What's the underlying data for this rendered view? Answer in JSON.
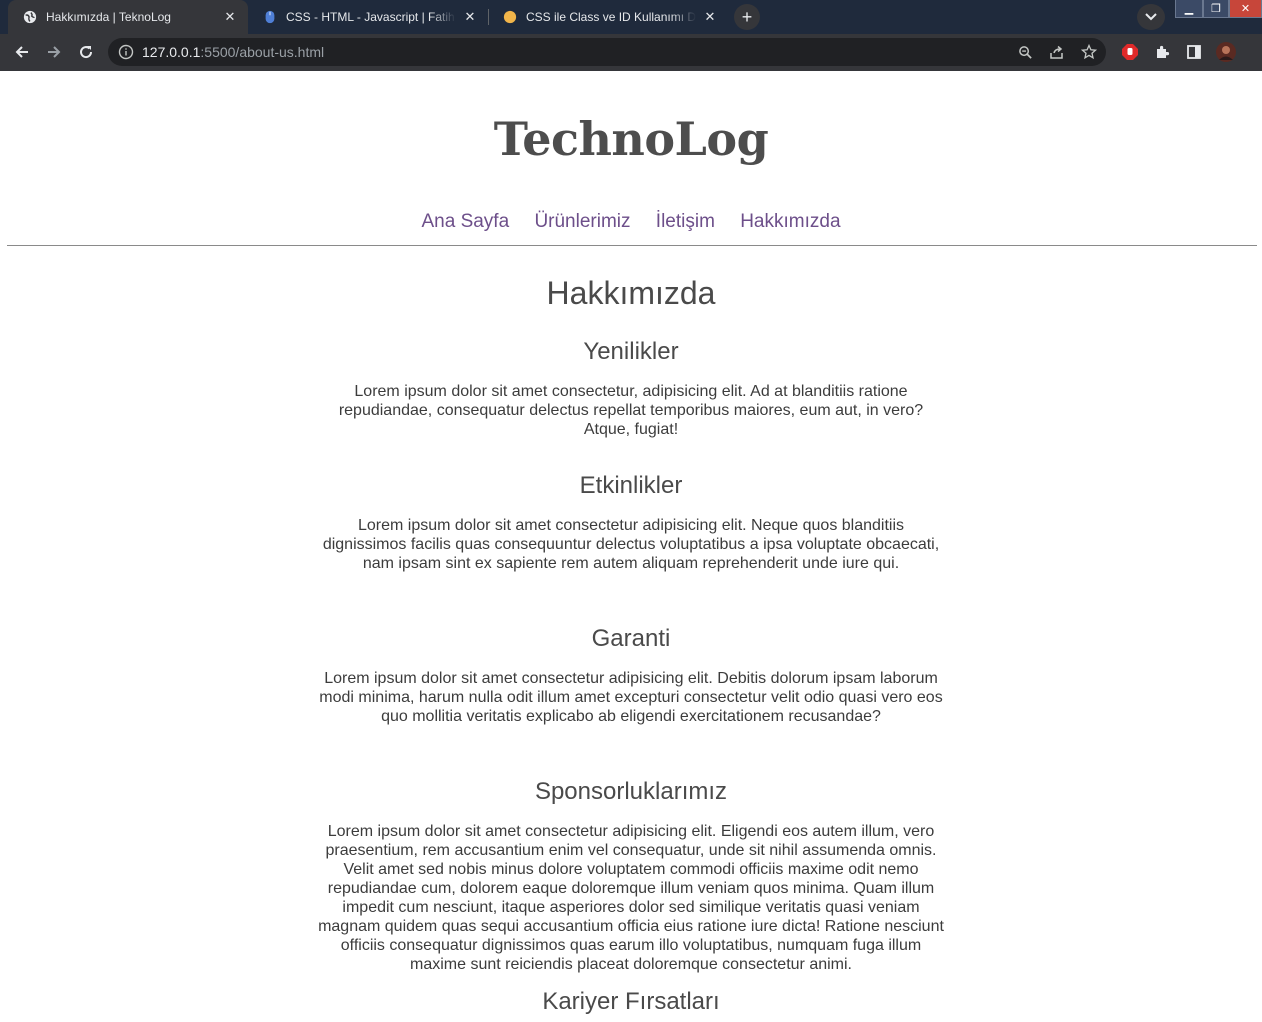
{
  "browser": {
    "tabs": [
      {
        "title": "Hakkımızda | TeknoLog",
        "active": true
      },
      {
        "title": "CSS - HTML - Javascript | Fatih Ha",
        "active": false
      },
      {
        "title": "CSS ile Class ve ID Kullanımı Ders",
        "active": false
      }
    ],
    "url_host": "127.0.0.1",
    "url_rest": ":5500/about-us.html"
  },
  "site": {
    "brand": "TechnoLog",
    "nav": [
      "Ana Sayfa",
      "Ürünlerimiz",
      "İletişim",
      "Hakkımızda"
    ]
  },
  "main": {
    "title": "Hakkımızda",
    "sections": [
      {
        "heading": "Yenilikler",
        "text": "Lorem ipsum dolor sit amet consectetur, adipisicing elit. Ad at blanditiis ratione repudiandae, consequatur delectus repellat temporibus maiores, eum aut, in vero? Atque, fugiat!"
      },
      {
        "heading": "Etkinlikler",
        "text": "Lorem ipsum dolor sit amet consectetur adipisicing elit. Neque quos blanditiis dignissimos facilis quas consequuntur delectus voluptatibus a ipsa voluptate obcaecati, nam ipsam sint ex sapiente rem autem aliquam reprehenderit unde iure qui."
      },
      {
        "heading": "Garanti",
        "text": "Lorem ipsum dolor sit amet consectetur adipisicing elit. Debitis dolorum ipsam laborum modi minima, harum nulla odit illum amet excepturi consectetur velit odio quasi vero eos quo mollitia veritatis explicabo ab eligendi exercitationem recusandae?"
      },
      {
        "heading": "Sponsorluklarımız",
        "text": "Lorem ipsum dolor sit amet consectetur adipisicing elit. Eligendi eos autem illum, vero praesentium, rem accusantium enim vel consequatur, unde sit nihil assumenda omnis. Velit amet sed nobis minus dolore voluptatem commodi officiis maxime odit nemo repudiandae cum, dolorem eaque doloremque illum veniam quos minima. Quam illum impedit cum nesciunt, itaque asperiores dolor sed similique veritatis quasi veniam magnam quidem quas sequi accusantium officia eius ratione iure dicta! Ratione nesciunt officiis consequatur dignissimos quas earum illo voluptatibus, numquam fuga illum maxime sunt reiciendis placeat doloremque consectetur animi."
      },
      {
        "heading": "Kariyer Fırsatları",
        "text": ""
      }
    ]
  }
}
